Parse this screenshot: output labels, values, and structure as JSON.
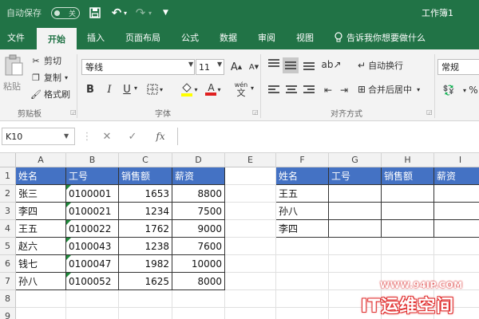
{
  "titlebar": {
    "autosave_label": "自动保存",
    "autosave_state": "关",
    "doc_title": "工作簿1"
  },
  "ribbon_tabs": [
    "文件",
    "开始",
    "插入",
    "页面布局",
    "公式",
    "数据",
    "审阅",
    "视图"
  ],
  "active_tab": "开始",
  "tell_me": "告诉我你想要做什么",
  "clipboard": {
    "paste": "粘贴",
    "cut": "剪切",
    "copy": "复制",
    "format_painter": "格式刷",
    "group_label": "剪贴板"
  },
  "font": {
    "name": "等线",
    "size": "11",
    "grow": "A",
    "shrink": "A",
    "bold": "B",
    "italic": "I",
    "underline": "U",
    "font_color_glyph": "A",
    "phonetic": "wén",
    "group_label": "字体",
    "highlight_color": "#ffff00",
    "font_color": "#e02020"
  },
  "alignment": {
    "wrap_text": "自动换行",
    "merge_center": "合并后居中",
    "group_label": "对齐方式"
  },
  "number": {
    "format": "常规",
    "percent": "%"
  },
  "formula_bar": {
    "name_box": "K10",
    "cancel": "✕",
    "enter": "✓",
    "fx": "fx",
    "value": ""
  },
  "sheet": {
    "columns": [
      "A",
      "B",
      "C",
      "D",
      "E",
      "F",
      "G",
      "H",
      "I"
    ],
    "rows": [
      "1",
      "2",
      "3",
      "4",
      "5",
      "6",
      "7",
      "8",
      "9"
    ],
    "left_table": {
      "headers": [
        "姓名",
        "工号",
        "销售额",
        "薪资"
      ],
      "rows": [
        [
          "张三",
          "0100001",
          "1653",
          "8800"
        ],
        [
          "李四",
          "0100021",
          "1234",
          "7500"
        ],
        [
          "王五",
          "0100022",
          "1762",
          "9000"
        ],
        [
          "赵六",
          "0100043",
          "1238",
          "7600"
        ],
        [
          "钱七",
          "0100047",
          "1982",
          "10000"
        ],
        [
          "孙八",
          "0100052",
          "1625",
          "8000"
        ]
      ]
    },
    "right_table": {
      "headers": [
        "姓名",
        "工号",
        "销售额",
        "薪资"
      ],
      "rows": [
        [
          "王五",
          "",
          "",
          ""
        ],
        [
          "孙八",
          "",
          "",
          ""
        ],
        [
          "李四",
          "",
          "",
          ""
        ]
      ]
    },
    "header_fill": "#4472c4"
  },
  "watermark": {
    "url": "WWW.94IP.COM",
    "brand": "IT运维空间"
  },
  "colors": {
    "excel_green": "#217346",
    "number_stored_as_text_marker": "#1e8a3a"
  }
}
